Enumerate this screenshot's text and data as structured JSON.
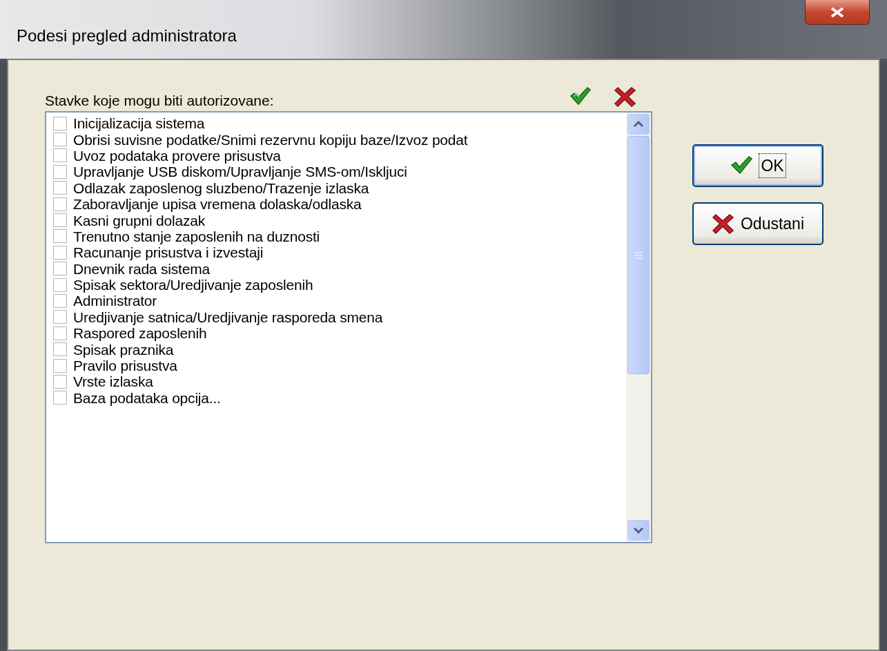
{
  "window": {
    "title": "Podesi pregled administratora"
  },
  "list_label": "Stavke koje mogu biti autorizovane:",
  "items": [
    {
      "label": "Inicijalizacija sistema",
      "checked": false
    },
    {
      "label": "Obrisi suvisne podatke/Snimi rezervnu kopiju baze/Izvoz podat",
      "checked": false
    },
    {
      "label": "Uvoz podataka provere prisustva",
      "checked": false
    },
    {
      "label": "Upravljanje USB diskom/Upravljanje SMS-om/Iskljuci",
      "checked": false
    },
    {
      "label": "Odlazak zaposlenog sluzbeno/Trazenje izlaska",
      "checked": false
    },
    {
      "label": "Zaboravljanje upisa vremena dolaska/odlaska",
      "checked": false
    },
    {
      "label": "Kasni grupni dolazak",
      "checked": false
    },
    {
      "label": "Trenutno stanje zaposlenih na duznosti",
      "checked": false
    },
    {
      "label": "Racunanje prisustva i izvestaji",
      "checked": false
    },
    {
      "label": "Dnevnik rada sistema",
      "checked": false
    },
    {
      "label": "Spisak sektora/Uredjivanje zaposlenih",
      "checked": false
    },
    {
      "label": "Administrator",
      "checked": false
    },
    {
      "label": "Uredjivanje satnica/Uredjivanje rasporeda smena",
      "checked": false
    },
    {
      "label": "Raspored zaposlenih",
      "checked": false
    },
    {
      "label": "Spisak praznika",
      "checked": false
    },
    {
      "label": "Pravilo prisustva",
      "checked": false
    },
    {
      "label": "Vrste izlaska",
      "checked": false
    },
    {
      "label": "Baza podataka opcija...",
      "checked": false
    }
  ],
  "buttons": [
    {
      "label": "OK",
      "kind": "ok"
    },
    {
      "label": "Odustani",
      "kind": "cancel"
    }
  ]
}
